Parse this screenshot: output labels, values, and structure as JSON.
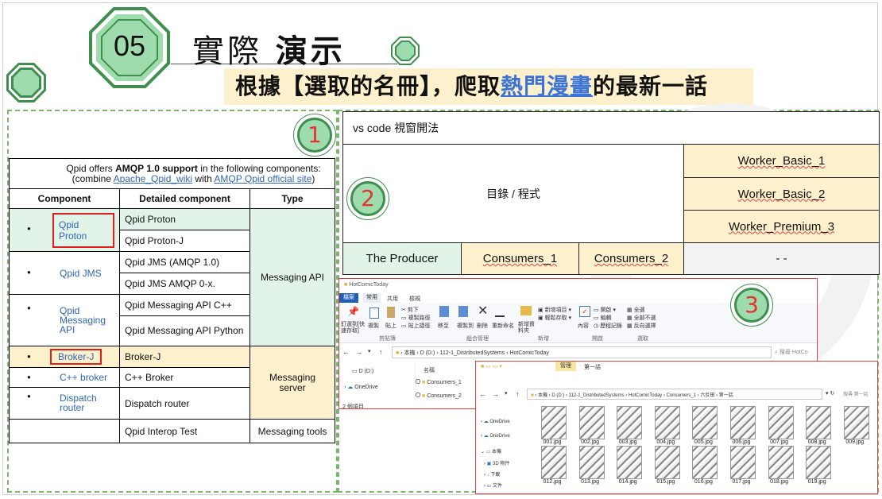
{
  "header": {
    "number": "05",
    "title_light": "實際",
    "title_bold": "演示",
    "subtitle_pre": "根據【選取的名冊】，爬取",
    "subtitle_link": "熱門漫畫",
    "subtitle_post": "的最新一話"
  },
  "markers": [
    "1",
    "2",
    "3"
  ],
  "qpid": {
    "intro_pre": "Qpid offers ",
    "intro_bold": "AMQP 1.0 support",
    "intro_post": " in the following components:",
    "intro2_pre": "(combine ",
    "intro2_link1": "Apache_Qpid_wiki",
    "intro2_mid": " with ",
    "intro2_link2": "AMQP Qpid official site",
    "intro2_post": ")",
    "headers": [
      "Component",
      "Detailed component",
      "Type"
    ],
    "components": [
      "Qpid Proton",
      "Qpid JMS",
      "Qpid Messaging API",
      "Broker-J",
      "C++ broker",
      "Dispatch router"
    ],
    "details": [
      "Qpid Proton",
      "Qpid Proton-J",
      "Qpid JMS (AMQP 1.0)",
      "Qpid JMS AMQP 0-x.",
      "Qpid Messaging API C++",
      "Qpid Messaging API Python",
      "Broker-J",
      "C++ Broker",
      "Dispatch router",
      "Qpid Interop Test"
    ],
    "types": [
      "Messaging API",
      "Messaging server",
      "Messaging tools"
    ],
    "bullet": "●"
  },
  "vscode": {
    "title": "vs code 視窗開法",
    "dir_label": "目錄 / 程式",
    "workers": [
      "Worker_Basic_1",
      "Worker_Basic_2",
      "Worker_Premium_3"
    ],
    "producer": "The Producer",
    "consumers": [
      "Consumers_1",
      "Consumers_2"
    ],
    "empty": "- -"
  },
  "explorer1": {
    "title": "HotComicToday",
    "tabs": [
      "檔案",
      "常用",
      "共用",
      "檢視"
    ],
    "ribbon": [
      "釘選到[快速存取]",
      "複製",
      "貼上",
      "剪下",
      "複製路徑",
      "貼上捷徑",
      "移至",
      "複製到",
      "刪除",
      "重新命名",
      "新增資料夾",
      "新增項目",
      "輕鬆存取",
      "內容",
      "開啟",
      "編輯",
      "歷程記錄",
      "全選",
      "全部不選",
      "反向選擇"
    ],
    "groups": [
      "剪貼簿",
      "組合管理",
      "新增",
      "開啟",
      "選取"
    ],
    "path": [
      "本機",
      "D (D:)",
      "112-1_DistributedSystems",
      "HotComicToday"
    ],
    "search": "搜尋 HotCo",
    "nav": [
      "D (D:)",
      "OneDrive"
    ],
    "col": "名稱",
    "files": [
      "Consumers_1",
      "Consumers_2"
    ],
    "status": "2 個項目"
  },
  "explorer2": {
    "tabs": [
      "管理",
      "第一話"
    ],
    "path": [
      "本機",
      "D (D:)",
      "112-1_DistributedSystems",
      "HotComicToday",
      "Consumers_1",
      "六反田",
      "第一話"
    ],
    "search": "搜尋 第一話",
    "nav": [
      "OneDrive",
      "OneDrive",
      "本機",
      "3D 物件",
      "下載",
      "文件"
    ],
    "images": [
      "001.jpg",
      "002.jpg",
      "003.jpg",
      "004.jpg",
      "005.jpg",
      "006.jpg",
      "007.jpg",
      "008.jpg",
      "009.jpg",
      "012.jpg",
      "013.jpg",
      "014.jpg",
      "015.jpg",
      "016.jpg",
      "017.jpg",
      "018.jpg",
      "019.jpg"
    ]
  }
}
